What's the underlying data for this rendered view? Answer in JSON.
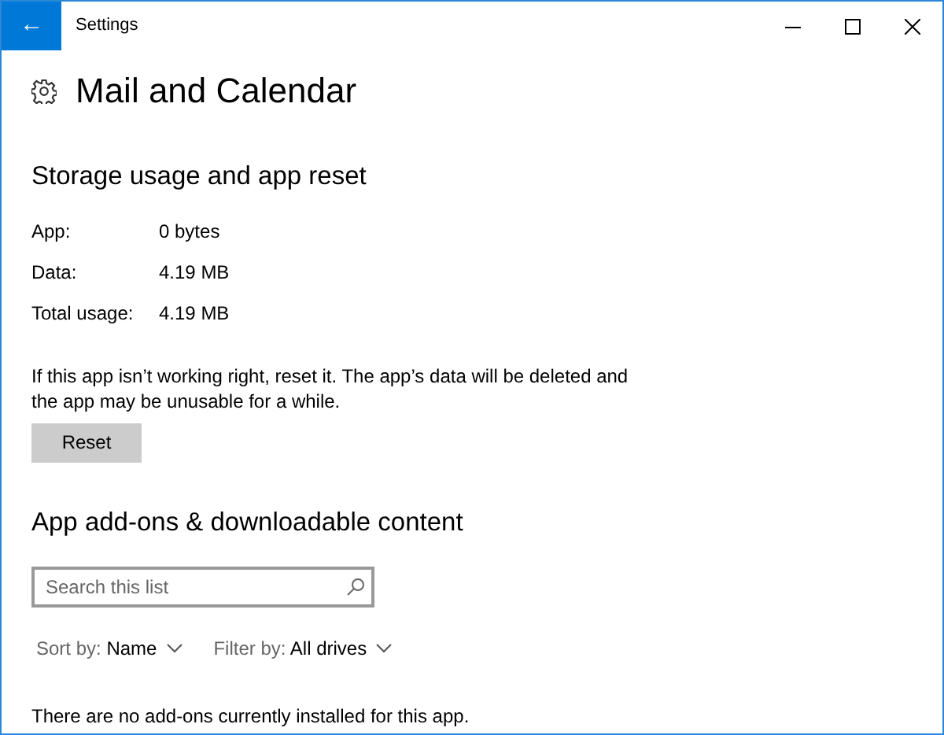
{
  "window": {
    "title": "Settings",
    "back_button": "←"
  },
  "page": {
    "title": "Mail and Calendar"
  },
  "storage": {
    "heading": "Storage usage and app reset",
    "rows": [
      {
        "label": "App:",
        "value": "0 bytes"
      },
      {
        "label": "Data:",
        "value": "4.19 MB"
      },
      {
        "label": "Total usage:",
        "value": "4.19 MB"
      }
    ],
    "note": "If this app isn’t working right, reset it. The app’s data will be deleted and the app may be unusable for a while.",
    "button": "Reset"
  },
  "addons": {
    "heading": "App add-ons & downloadable content",
    "search": {
      "placeholder": "Search this list"
    },
    "dropdowns": [
      {
        "label": "Sort by:",
        "value": "Name"
      },
      {
        "label": "Filter by:",
        "value": "All drives"
      }
    ],
    "message": "There are no add-ons currently installed for this app."
  }
}
